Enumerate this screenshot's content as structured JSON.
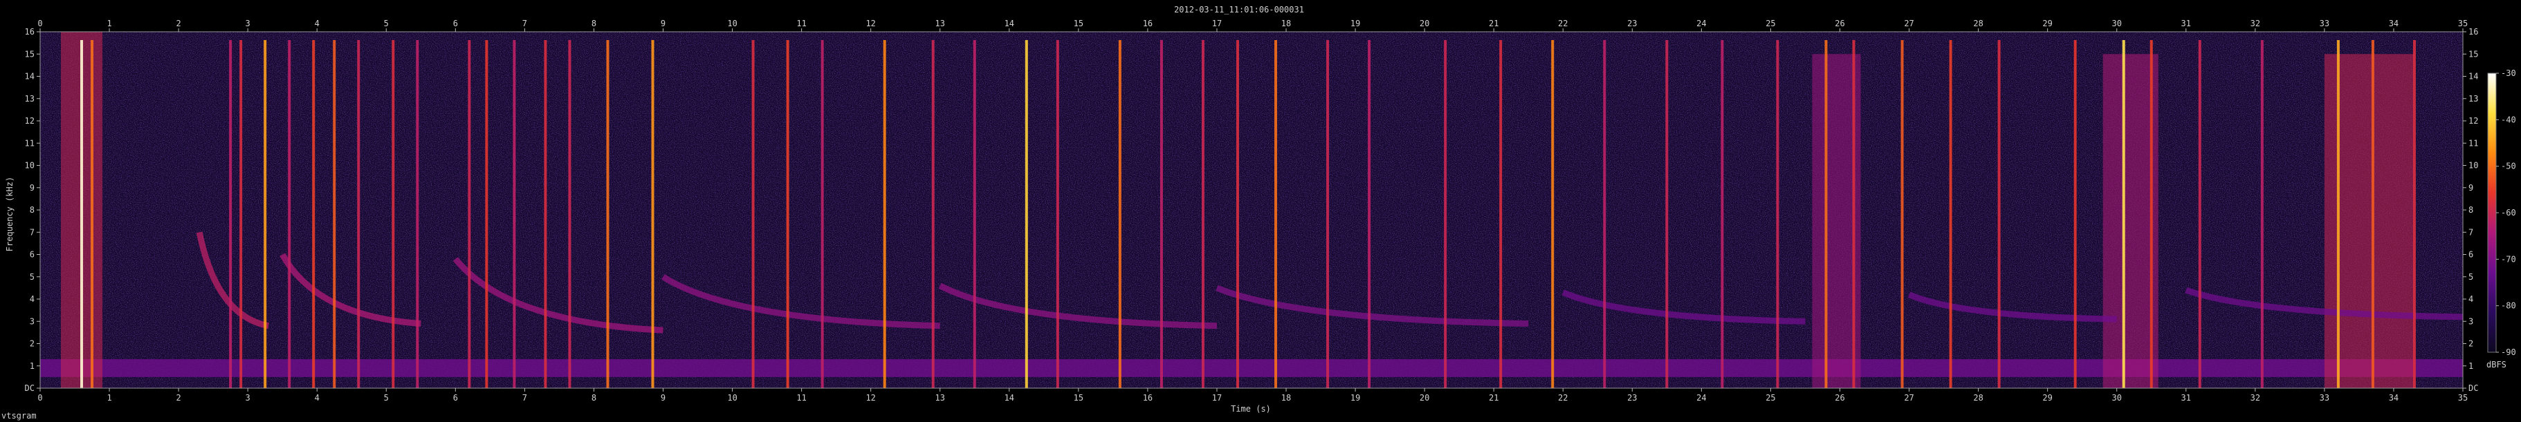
{
  "chart_data": {
    "type": "heatmap",
    "title": "2012-03-11_11:01:06-000031",
    "xlabel": "Time (s)",
    "ylabel": "Frequency (kHz)",
    "footer_label": "vtsgram",
    "xlim": [
      0,
      35
    ],
    "ylim": [
      0,
      16
    ],
    "x_ticks": [
      "0",
      "1",
      "2",
      "3",
      "4",
      "5",
      "6",
      "7",
      "8",
      "9",
      "10",
      "11",
      "12",
      "13",
      "14",
      "15",
      "16",
      "17",
      "18",
      "19",
      "20",
      "21",
      "22",
      "23",
      "24",
      "25",
      "26",
      "27",
      "28",
      "29",
      "30",
      "31",
      "32",
      "33",
      "34",
      "35"
    ],
    "y_ticks": [
      "DC",
      "1",
      "2",
      "3",
      "4",
      "5",
      "6",
      "7",
      "8",
      "9",
      "10",
      "11",
      "12",
      "13",
      "14",
      "15",
      "16"
    ],
    "colorbar": {
      "label": "dBFS",
      "ticks": [
        "-30",
        "-40",
        "-50",
        "-60",
        "-70",
        "-80",
        "-90"
      ],
      "range": [
        -90,
        -30
      ],
      "colors": [
        "#0d0820",
        "#2a0a5e",
        "#6a0d8f",
        "#b0187a",
        "#e8362a",
        "#ff8c10",
        "#ffe040",
        "#ffffff"
      ]
    },
    "background_level_dbfs": -88,
    "low_band": {
      "f_min_khz": 0.5,
      "f_max_khz": 1.3,
      "level_dbfs": -72
    },
    "clicks": [
      {
        "t": 0.6,
        "level_dbfs": -32
      },
      {
        "t": 0.75,
        "level_dbfs": -50
      },
      {
        "t": 2.75,
        "level_dbfs": -62
      },
      {
        "t": 2.9,
        "level_dbfs": -58
      },
      {
        "t": 3.25,
        "level_dbfs": -45
      },
      {
        "t": 3.6,
        "level_dbfs": -62
      },
      {
        "t": 3.95,
        "level_dbfs": -55
      },
      {
        "t": 4.25,
        "level_dbfs": -52
      },
      {
        "t": 4.6,
        "level_dbfs": -60
      },
      {
        "t": 5.1,
        "level_dbfs": -58
      },
      {
        "t": 5.45,
        "level_dbfs": -62
      },
      {
        "t": 6.2,
        "level_dbfs": -60
      },
      {
        "t": 6.45,
        "level_dbfs": -56
      },
      {
        "t": 6.85,
        "level_dbfs": -62
      },
      {
        "t": 7.3,
        "level_dbfs": -58
      },
      {
        "t": 7.65,
        "level_dbfs": -60
      },
      {
        "t": 8.2,
        "level_dbfs": -50
      },
      {
        "t": 8.85,
        "level_dbfs": -46
      },
      {
        "t": 10.3,
        "level_dbfs": -58
      },
      {
        "t": 10.8,
        "level_dbfs": -55
      },
      {
        "t": 11.3,
        "level_dbfs": -62
      },
      {
        "t": 12.2,
        "level_dbfs": -48
      },
      {
        "t": 12.9,
        "level_dbfs": -60
      },
      {
        "t": 13.5,
        "level_dbfs": -62
      },
      {
        "t": 14.25,
        "level_dbfs": -40
      },
      {
        "t": 14.7,
        "level_dbfs": -60
      },
      {
        "t": 15.6,
        "level_dbfs": -50
      },
      {
        "t": 16.2,
        "level_dbfs": -62
      },
      {
        "t": 16.8,
        "level_dbfs": -60
      },
      {
        "t": 17.3,
        "level_dbfs": -58
      },
      {
        "t": 17.85,
        "level_dbfs": -50
      },
      {
        "t": 18.6,
        "level_dbfs": -60
      },
      {
        "t": 19.2,
        "level_dbfs": -62
      },
      {
        "t": 20.3,
        "level_dbfs": -60
      },
      {
        "t": 21.1,
        "level_dbfs": -58
      },
      {
        "t": 21.85,
        "level_dbfs": -48
      },
      {
        "t": 22.6,
        "level_dbfs": -62
      },
      {
        "t": 23.5,
        "level_dbfs": -60
      },
      {
        "t": 24.3,
        "level_dbfs": -62
      },
      {
        "t": 25.1,
        "level_dbfs": -60
      },
      {
        "t": 25.8,
        "level_dbfs": -50
      },
      {
        "t": 26.2,
        "level_dbfs": -58
      },
      {
        "t": 26.9,
        "level_dbfs": -52
      },
      {
        "t": 27.6,
        "level_dbfs": -55
      },
      {
        "t": 28.3,
        "level_dbfs": -58
      },
      {
        "t": 29.4,
        "level_dbfs": -56
      },
      {
        "t": 30.1,
        "level_dbfs": -38
      },
      {
        "t": 30.5,
        "level_dbfs": -55
      },
      {
        "t": 31.2,
        "level_dbfs": -60
      },
      {
        "t": 32.1,
        "level_dbfs": -62
      },
      {
        "t": 33.2,
        "level_dbfs": -44
      },
      {
        "t": 33.7,
        "level_dbfs": -52
      },
      {
        "t": 34.3,
        "level_dbfs": -58
      }
    ],
    "sweeps": [
      {
        "t_start": 2.3,
        "t_end": 3.3,
        "f_start_khz": 7.0,
        "f_end_khz": 2.8,
        "level_dbfs": -62
      },
      {
        "t_start": 3.5,
        "t_end": 5.5,
        "f_start_khz": 6.0,
        "f_end_khz": 2.9,
        "level_dbfs": -64
      },
      {
        "t_start": 6.0,
        "t_end": 9.0,
        "f_start_khz": 5.8,
        "f_end_khz": 2.6,
        "level_dbfs": -66
      },
      {
        "t_start": 9.0,
        "t_end": 13.0,
        "f_start_khz": 5.0,
        "f_end_khz": 2.8,
        "level_dbfs": -68
      },
      {
        "t_start": 13.0,
        "t_end": 17.0,
        "f_start_khz": 4.6,
        "f_end_khz": 2.8,
        "level_dbfs": -68
      },
      {
        "t_start": 17.0,
        "t_end": 21.5,
        "f_start_khz": 4.5,
        "f_end_khz": 2.9,
        "level_dbfs": -70
      },
      {
        "t_start": 22.0,
        "t_end": 25.5,
        "f_start_khz": 4.3,
        "f_end_khz": 3.0,
        "level_dbfs": -72
      },
      {
        "t_start": 27.0,
        "t_end": 30.0,
        "f_start_khz": 4.2,
        "f_end_khz": 3.1,
        "level_dbfs": -72
      },
      {
        "t_start": 31.0,
        "t_end": 35.0,
        "f_start_khz": 4.4,
        "f_end_khz": 3.2,
        "level_dbfs": -72
      }
    ],
    "dense_regions": [
      {
        "t_start": 0.3,
        "t_end": 0.9,
        "f_min_khz": 0,
        "f_max_khz": 16,
        "level_dbfs": -60
      },
      {
        "t_start": 25.6,
        "t_end": 26.3,
        "f_min_khz": 0,
        "f_max_khz": 15,
        "level_dbfs": -66
      },
      {
        "t_start": 29.8,
        "t_end": 30.6,
        "f_min_khz": 0,
        "f_max_khz": 15,
        "level_dbfs": -64
      },
      {
        "t_start": 33.0,
        "t_end": 34.3,
        "f_min_khz": 0,
        "f_max_khz": 15,
        "level_dbfs": -60
      }
    ],
    "grid": false,
    "legend": "colorbar-right"
  }
}
